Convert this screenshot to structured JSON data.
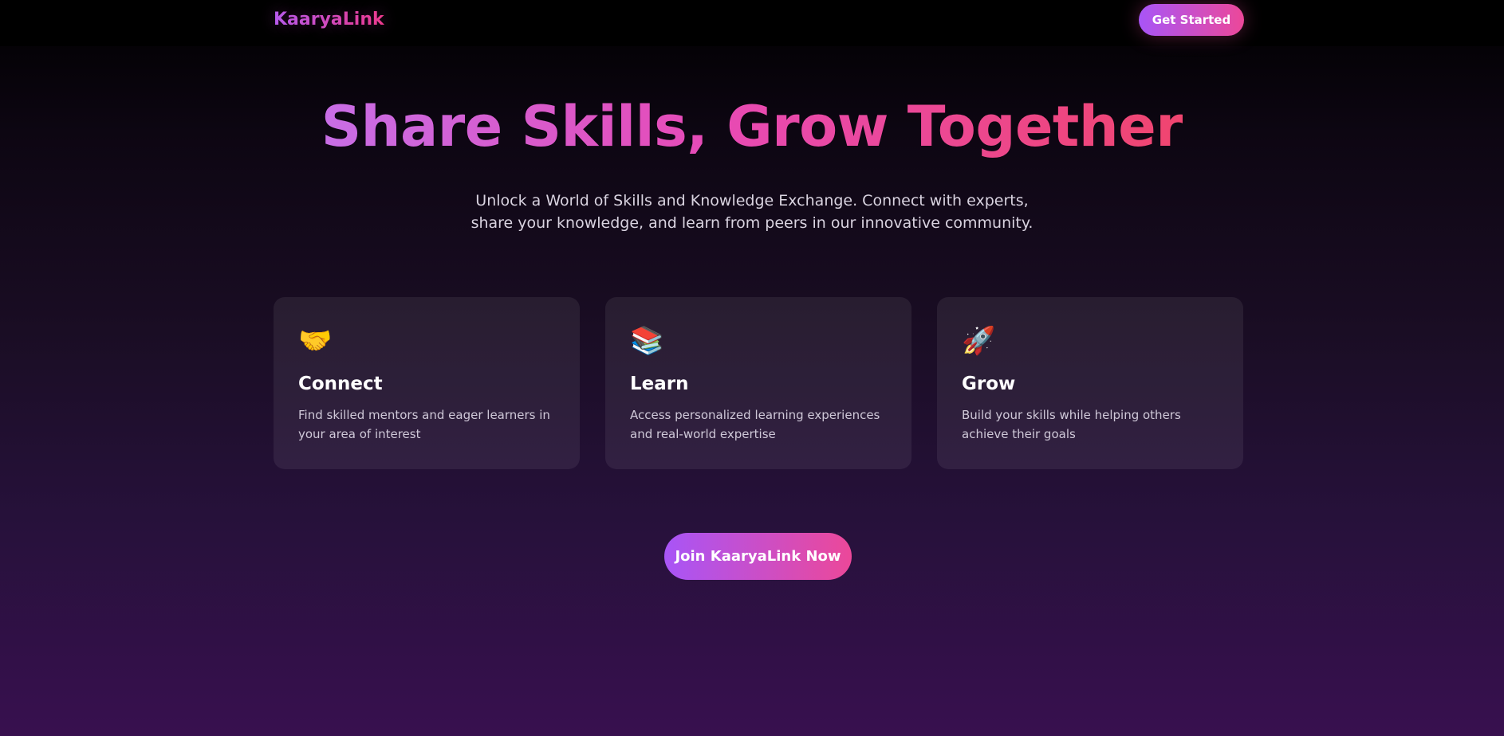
{
  "nav": {
    "brand": "KaaryaLink",
    "cta_label": "Get Started"
  },
  "hero": {
    "title": "Share Skills, Grow Together",
    "subtitle": "Unlock a World of Skills and Knowledge Exchange. Connect with experts, share your knowledge, and learn from peers in our innovative community."
  },
  "features": [
    {
      "icon": "🤝",
      "icon_name": "handshake-icon",
      "title": "Connect",
      "description": "Find skilled mentors and eager learners in your area of interest"
    },
    {
      "icon": "📚",
      "icon_name": "books-icon",
      "title": "Learn",
      "description": "Access personalized learning experiences and real-world expertise"
    },
    {
      "icon": "🚀",
      "icon_name": "rocket-icon",
      "title": "Grow",
      "description": "Build your skills while helping others achieve their goals"
    }
  ],
  "cta": {
    "label": "Join KaaryaLink Now"
  },
  "colors": {
    "accent_start": "#a855f7",
    "accent_end": "#ec4899"
  }
}
